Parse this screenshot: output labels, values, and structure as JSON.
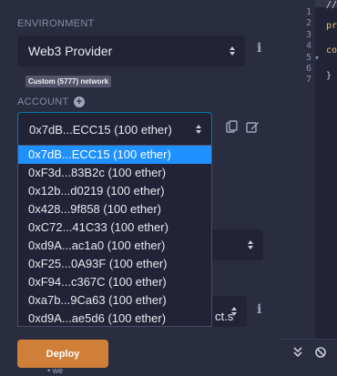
{
  "environment": {
    "label": "ENVIRONMENT",
    "selected": "Web3 Provider",
    "network_badge": "Custom (5777) network",
    "info_icon": "info-icon"
  },
  "account": {
    "label": "ACCOUNT",
    "selected": "0x7dB...ECC15 (100 ether)",
    "add_icon": "plus-circle-icon",
    "copy_icon": "copy-icon",
    "edit_icon": "edit-icon",
    "options": [
      "0x7dB...ECC15 (100 ether)",
      "0xF3d...83B2c (100 ether)",
      "0x12b...d0219 (100 ether)",
      "0x428...9f858 (100 ether)",
      "0xC72...41C33 (100 ether)",
      "0xd9A...ac1a0 (100 ether)",
      "0xF25...0A93F (100 ether)",
      "0xF94...c367C (100 ether)",
      "0xa7b...9Ca63 (100 ether)",
      "0xd9A...ae5d6 (100 ether)"
    ]
  },
  "contract": {
    "visible_fragment": "ct.s"
  },
  "deploy": {
    "label": "Deploy"
  },
  "editor": {
    "line_numbers": [
      "1",
      "2",
      "3",
      "4",
      "5",
      "6",
      "7"
    ],
    "code_lines": [
      "//",
      "",
      "pr",
      "",
      "co",
      "",
      "}"
    ],
    "fold_marker": "▾"
  },
  "terminal": {
    "collapse_icon": "chevrons-down-icon",
    "clear_icon": "ban-icon",
    "text": "• we"
  },
  "colors": {
    "panel_bg": "#2a2c3f",
    "input_bg": "#222336",
    "accent": "#1e90ff",
    "deploy": "#d07f38"
  }
}
